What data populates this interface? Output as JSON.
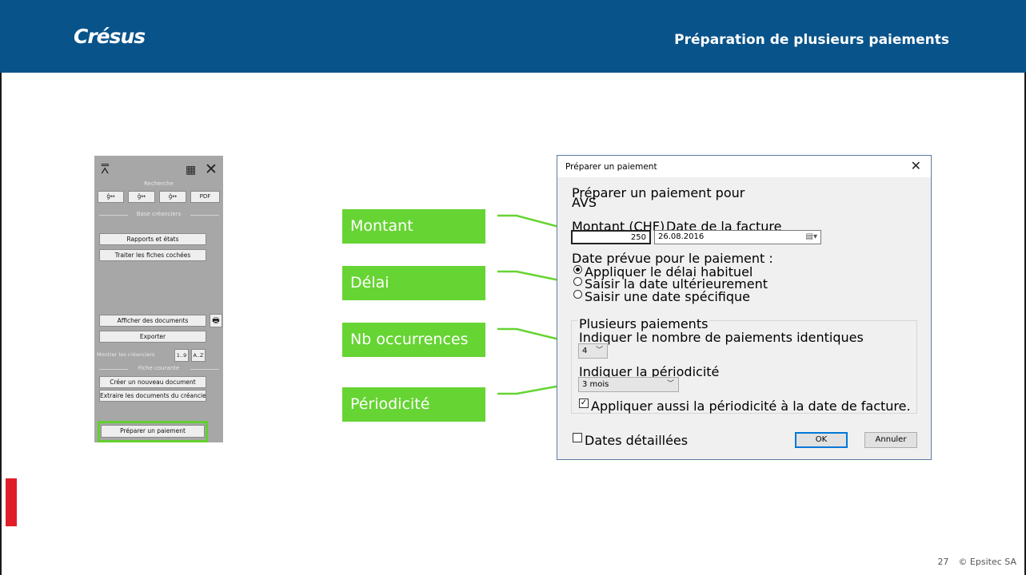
{
  "header": {
    "logo": "Crésus",
    "title": "Préparation de plusieurs paiements"
  },
  "footer": {
    "page": "27",
    "copyright": "© Epsitec SA"
  },
  "panel": {
    "section_search": "Recherche",
    "search_buttons": [
      "ĝ↔ ",
      "ĝ↔ ",
      "ĝ↔ ",
      "PDF"
    ],
    "section_base": "Base créanciers",
    "btn_reports": "Rapports et états",
    "btn_process": "Traiter les fiches cochées",
    "btn_show_docs": "Afficher des documents",
    "btn_export": "Exporter",
    "show_label": "Montrer les créanciers",
    "sort_num": "1..9",
    "sort_alpha": "A..Z",
    "section_current": "Fiche courante",
    "btn_new_doc": "Créer un nouveau document",
    "btn_extract": "Extraire les documents du créancier",
    "btn_prepare": "Préparer un paiement"
  },
  "callouts": [
    "Montant",
    "Délai",
    "Nb occurrences",
    "Périodicité"
  ],
  "dialog": {
    "title": "Préparer un paiement",
    "prepare_for_label": "Préparer un paiement pour",
    "creditor": "AVS",
    "amount_label": "Montant (CHF)",
    "amount_value": "250",
    "invoice_date_label": "Date de la facture",
    "invoice_date_value": "26.08.2016",
    "planned_date_label": "Date prévue pour le paiement :",
    "radio_options": [
      {
        "label": "Appliquer le délai habituel",
        "checked": true
      },
      {
        "label": "Saisir la date ultérieurement",
        "checked": false
      },
      {
        "label": "Saisir une date spécifique",
        "checked": false
      }
    ],
    "group_title": "Plusieurs paiements",
    "count_label": "Indiquer le nombre de paiements identiques",
    "count_value": "4",
    "period_label": "Indiquer la périodicité",
    "period_value": "3 mois",
    "apply_period_label": "Appliquer aussi la périodicité à la date de facture.",
    "apply_period_checked": true,
    "detailed_dates_label": "Dates détaillées",
    "detailed_dates_checked": false,
    "ok_label": "OK",
    "cancel_label": "Annuler"
  },
  "colors": {
    "header_blue": "#08538a",
    "callout_green": "#66d433",
    "accent_red": "#e01e2a"
  }
}
